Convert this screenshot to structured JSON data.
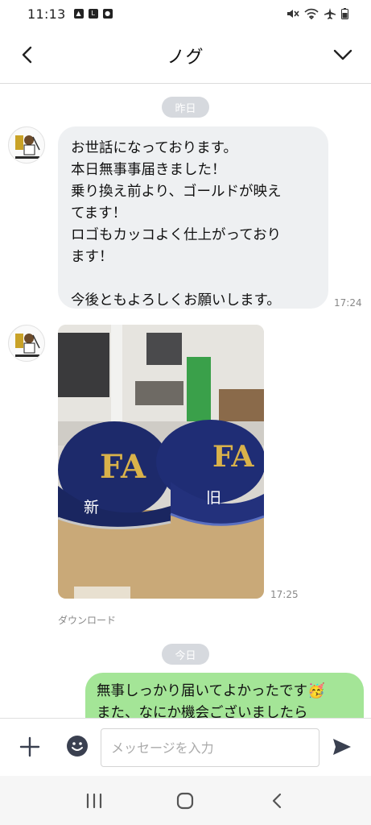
{
  "status_bar": {
    "time": "11:13"
  },
  "header": {
    "title": "ノグ",
    "back_icon": "chevron-left-icon",
    "menu_icon": "chevron-down-icon"
  },
  "chat": {
    "date_yesterday": "昨日",
    "message1": {
      "text": "お世話になっております。\n本日無事事届きました！\n乗り換え前より、ゴールドが映え\nてます！\nロゴもカッコよく仕上がっており\nます！\n\n今後ともよろしくお願いします。",
      "time": "17:24"
    },
    "message2": {
      "photo_labels": {
        "new": "新",
        "old": "旧"
      },
      "time": "17:25",
      "download_label": "ダウンロード"
    },
    "date_today": "今日",
    "message3": {
      "text": "無事しっかり届いてよかったです🥳\nまた、なにか機会ございましたら"
    }
  },
  "input": {
    "placeholder": "メッセージを入力"
  },
  "colors": {
    "outgoing": "#a4e597",
    "incoming": "#eef0f2",
    "pill": "#d6d9de"
  }
}
